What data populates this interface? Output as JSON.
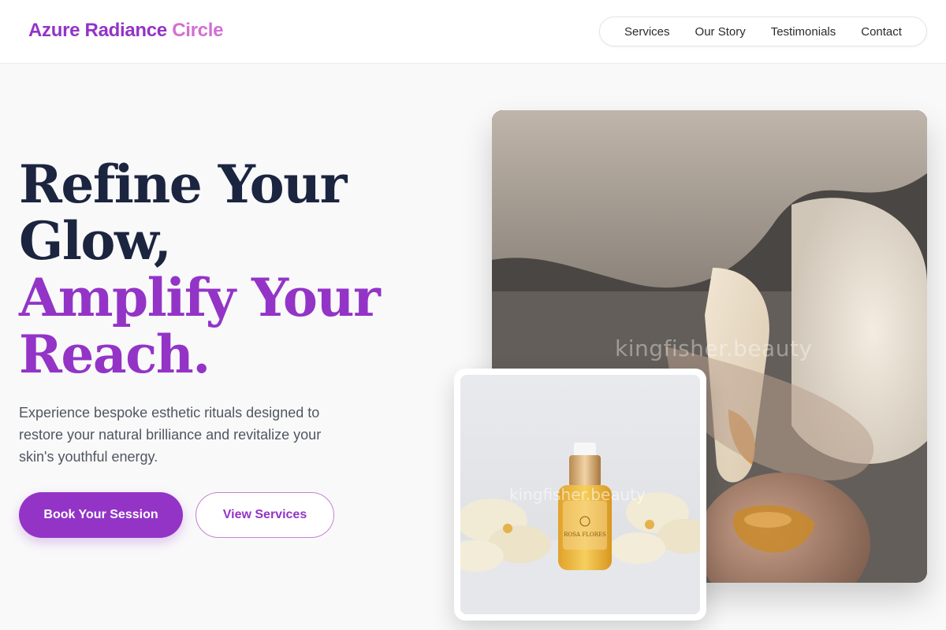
{
  "brand": {
    "name_part1": "Azure Radiance",
    "name_part2": "Circle"
  },
  "nav": {
    "items": [
      {
        "label": "Services"
      },
      {
        "label": "Our Story"
      },
      {
        "label": "Testimonials"
      },
      {
        "label": "Contact"
      }
    ]
  },
  "hero": {
    "headline_dark_1": "Refine Your",
    "headline_dark_2": "Glow,",
    "headline_accent_1": "Amplify Your",
    "headline_accent_2": "Reach.",
    "description": "Experience bespoke esthetic rituals designed to restore your natural brilliance and revitalize your skin's youthful energy.",
    "primary_cta": "Book Your Session",
    "secondary_cta": "View Services"
  },
  "images": {
    "main_watermark": "kingfisher.beauty",
    "inset_watermark": "kingfisher.beauty",
    "bottle_label": "ROSA FLORES"
  },
  "colors": {
    "accent": "#9334c7",
    "accent_light": "#d26fd2",
    "heading_dark": "#1b2540",
    "body_text": "#505660"
  }
}
